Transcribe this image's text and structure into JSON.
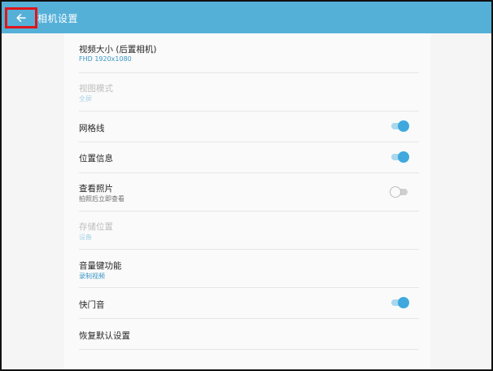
{
  "header": {
    "title": "相机设置",
    "back_icon": "arrow-left-icon",
    "color": "#55b0d8"
  },
  "settings": [
    {
      "label": "视频大小 (后置相机)",
      "sub": "FHD 1920x1080"
    },
    {
      "label": "视图模式",
      "sub": "全屏"
    },
    {
      "label": "网格线",
      "toggle": true
    },
    {
      "label": "位置信息",
      "toggle": true
    },
    {
      "label": "查看照片",
      "sub": "拍照后立即查看",
      "toggle": false
    },
    {
      "label": "存储位置",
      "sub": "设备"
    },
    {
      "label": "音量键功能",
      "sub": "录制视频"
    },
    {
      "label": "快门音",
      "toggle": true
    },
    {
      "label": "恢复默认设置"
    }
  ]
}
